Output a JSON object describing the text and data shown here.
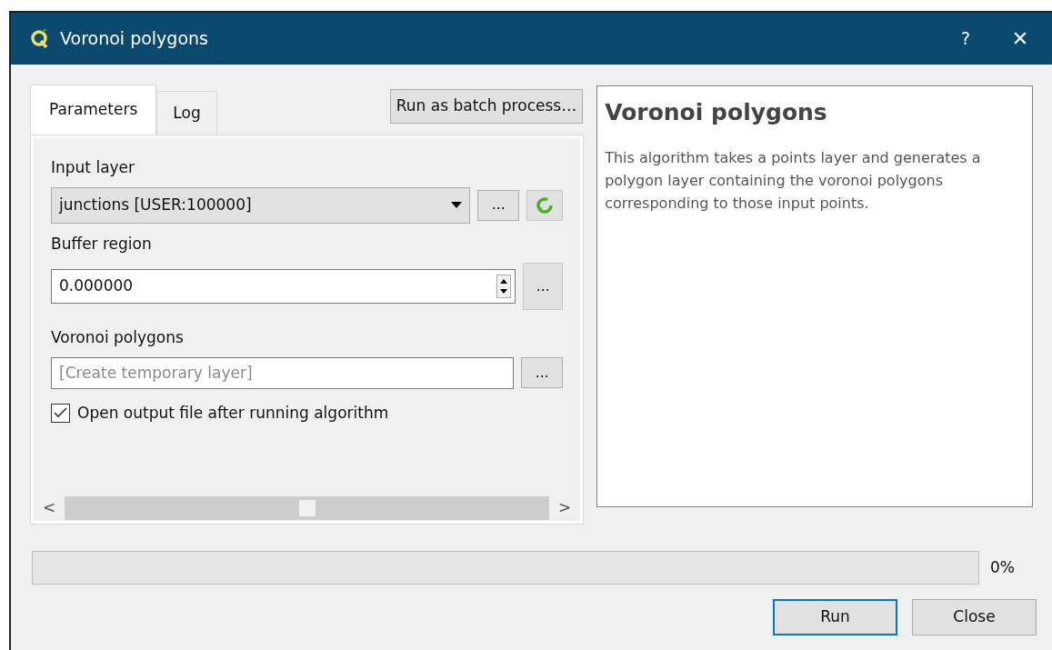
{
  "window": {
    "title": "Voronoi polygons",
    "help": "?",
    "close": "✕"
  },
  "tabs": [
    {
      "label": "Parameters",
      "selected": true
    },
    {
      "label": "Log",
      "selected": false
    }
  ],
  "batch_button": "Run as batch process…",
  "params": [
    {
      "kind": "combo",
      "label": "Input layer",
      "value": "junctions [USER:100000]",
      "more": "…"
    },
    {
      "kind": "number",
      "label": "Buffer region",
      "value": "0.000000",
      "more": "…"
    },
    {
      "kind": "output",
      "label": "Voronoi polygons",
      "placeholder": "[Create temporary layer]",
      "more": "…"
    },
    {
      "kind": "checkbox",
      "label": "Open output file after running algorithm",
      "checked": true
    }
  ],
  "scroll": {
    "left": "<",
    "right": ">"
  },
  "help": {
    "title": "Voronoi polygons",
    "text": "This algorithm takes a points layer and generates a polygon layer containing the voronoi polygons corresponding to those input points."
  },
  "progress": {
    "level": 0,
    "reading": "0%"
  },
  "buttons": [
    {
      "label": "Run",
      "selected": true
    },
    {
      "label": "Close",
      "selected": false
    }
  ]
}
